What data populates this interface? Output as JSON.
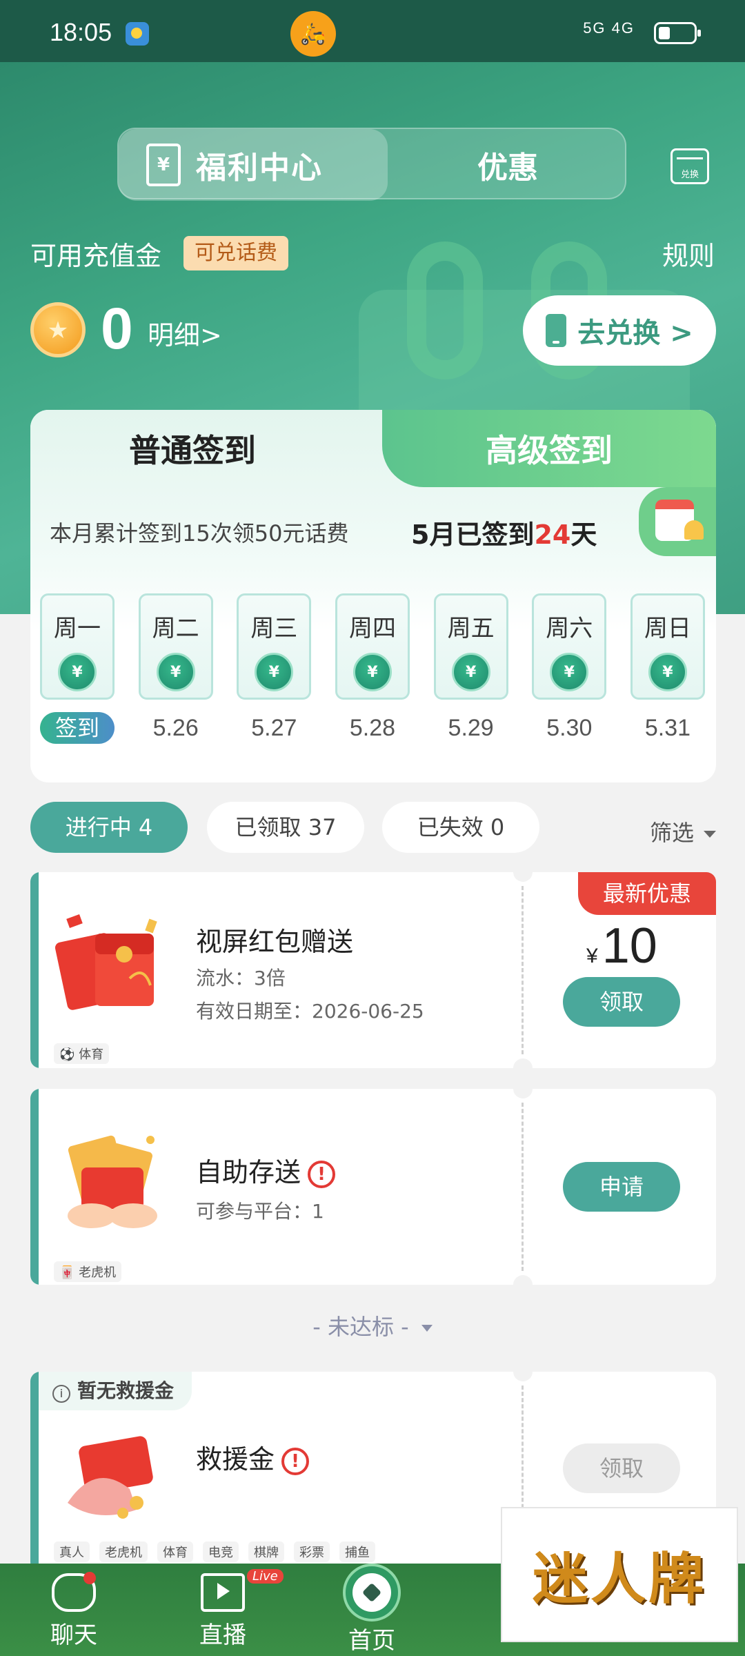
{
  "status_bar": {
    "time": "18:05",
    "network": "5G 4G"
  },
  "header": {
    "tab_active": "福利中心",
    "tab_inactive": "优惠",
    "exchange_icon_label": "兑换",
    "balance_label": "可用充值金",
    "balance_badge": "可兑话费",
    "rules_link": "规则",
    "balance_amount": "0",
    "detail_link": "明细>",
    "go_exchange_button": "去兑换 >"
  },
  "signin": {
    "tab_normal": "普通签到",
    "tab_advanced": "高级签到",
    "summary": "本月累计签到15次领50元话费",
    "month_prefix": "5月已签到",
    "month_count": "24",
    "month_suffix": "天",
    "days": [
      {
        "weekday": "周一",
        "date": "签到"
      },
      {
        "weekday": "周二",
        "date": "5.26"
      },
      {
        "weekday": "周三",
        "date": "5.27"
      },
      {
        "weekday": "周四",
        "date": "5.28"
      },
      {
        "weekday": "周五",
        "date": "5.29"
      },
      {
        "weekday": "周六",
        "date": "5.30"
      },
      {
        "weekday": "周日",
        "date": "5.31"
      }
    ],
    "yuan_symbol": "¥"
  },
  "filters": {
    "in_progress": "进行中 4",
    "claimed": "已领取 37",
    "expired": "已失效 0",
    "filter_label": "筛选"
  },
  "coupons": [
    {
      "title": "视屏红包赠送",
      "line1": "流水：3倍",
      "line2": "有效日期至：2026-06-25",
      "tag": "⚽ 体育",
      "badge": "最新优惠",
      "currency": "¥",
      "amount": "10",
      "button": "领取"
    },
    {
      "title": "自助存送",
      "line1": "可参与平台：1",
      "tag": "🀄 老虎机",
      "button": "申请"
    }
  ],
  "not_reached": "- 未达标 -",
  "rescue": {
    "badge": "暂无救援金",
    "title": "救援金",
    "button": "领取",
    "tags": [
      "真人",
      "老虎机",
      "体育",
      "电竞",
      "棋牌",
      "彩票",
      "捕鱼"
    ]
  },
  "bottom_nav": {
    "chat": "聊天",
    "live": "直播",
    "live_badge": "Live",
    "home": "首页"
  },
  "watermark_text": "迷人牌"
}
